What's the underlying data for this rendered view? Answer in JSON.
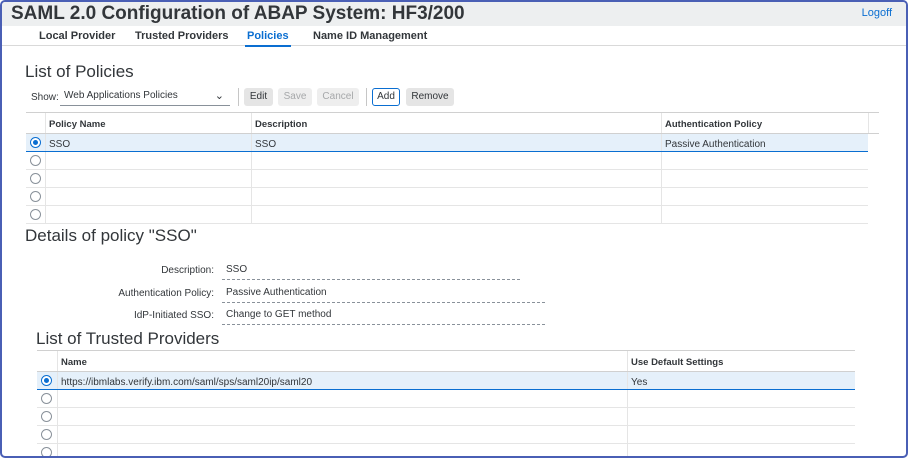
{
  "header": {
    "title": "SAML 2.0 Configuration of ABAP System: HF3/200",
    "logoff": "Logoff"
  },
  "tabs": [
    {
      "label": "Local Provider",
      "active": false
    },
    {
      "label": "Trusted Providers",
      "active": false
    },
    {
      "label": "Policies",
      "active": true
    },
    {
      "label": "Name ID Management",
      "active": false
    }
  ],
  "policies": {
    "title": "List of Policies",
    "show_label": "Show:",
    "show_value": "Web Applications Policies",
    "buttons": {
      "edit": "Edit",
      "save": "Save",
      "cancel": "Cancel",
      "add": "Add",
      "remove": "Remove"
    },
    "columns": [
      "Policy Name",
      "Description",
      "Authentication Policy"
    ],
    "rows": [
      [
        "SSO",
        "SSO",
        "Passive Authentication"
      ],
      [
        "",
        "",
        ""
      ],
      [
        "",
        "",
        ""
      ],
      [
        "",
        "",
        ""
      ],
      [
        "",
        "",
        ""
      ]
    ]
  },
  "details": {
    "title": "Details of policy \"SSO\"",
    "fields": [
      {
        "label": "Description:",
        "value": "SSO"
      },
      {
        "label": "Authentication Policy:",
        "value": "Passive Authentication"
      },
      {
        "label": "IdP-Initiated SSO:",
        "value": "Change to GET method"
      }
    ]
  },
  "trusted": {
    "title": "List of Trusted Providers",
    "columns": [
      "Name",
      "Use Default Settings"
    ],
    "rows": [
      [
        "https://ibmlabs.verify.ibm.com/saml/sps/saml20ip/saml20",
        "Yes"
      ],
      [
        "",
        ""
      ],
      [
        "",
        ""
      ],
      [
        "",
        ""
      ],
      [
        "",
        ""
      ]
    ]
  },
  "colors": {
    "accent": "#0a6ed1",
    "frame": "#4a5fb5",
    "selected_row": "#e5f0fa"
  }
}
